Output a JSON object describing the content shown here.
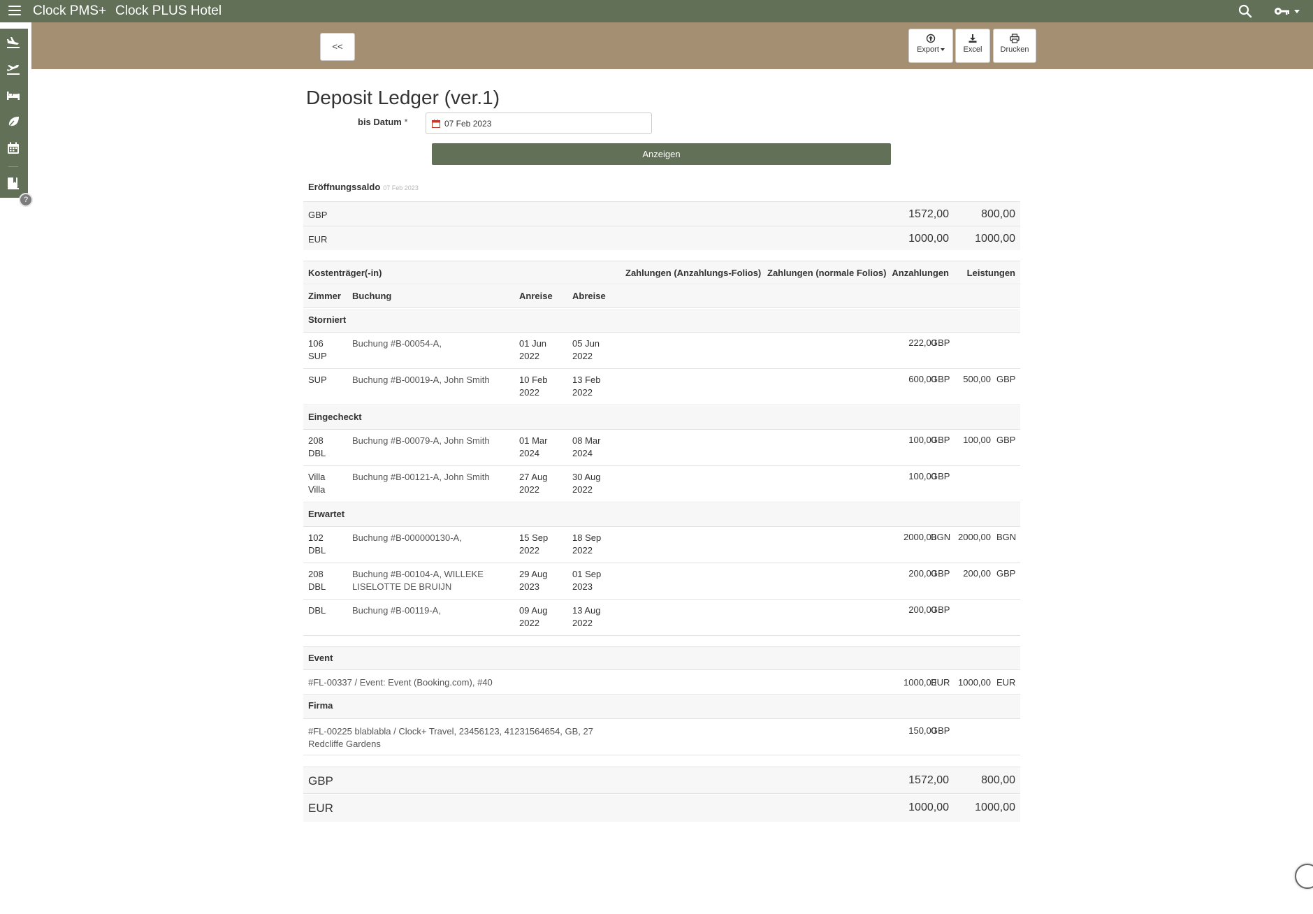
{
  "app": {
    "brand": "Clock PMS+",
    "hotel": "Clock PLUS Hotel"
  },
  "toolbar": {
    "back_label": "<<",
    "export_label": "Export",
    "excel_label": "Excel",
    "print_label": "Drucken"
  },
  "sidebar": {
    "items": [
      {
        "icon": "plane-arrival-icon"
      },
      {
        "icon": "plane-departure-icon"
      },
      {
        "icon": "bed-icon"
      },
      {
        "icon": "leaf-icon"
      },
      {
        "icon": "calendar-icon"
      },
      {
        "icon": "bookmark-book-icon"
      }
    ],
    "help": "?"
  },
  "page": {
    "title": "Deposit Ledger (ver.1)",
    "date_label": "bis Datum",
    "required_mark": "*",
    "date_value": "07 Feb 2023",
    "show_button": "Anzeigen"
  },
  "opening": {
    "label": "Eröffnungssaldo",
    "date": "07 Feb 2023",
    "rows": [
      {
        "currency": "GBP",
        "deposits": "1572,00",
        "services": "800,00"
      },
      {
        "currency": "EUR",
        "deposits": "1000,00",
        "services": "1000,00"
      }
    ]
  },
  "headers": {
    "payer": "Kostenträger(-in)",
    "payments_deposit": "Zahlungen (Anzahlungs-Folios)",
    "payments_normal": "Zahlungen (normale Folios)",
    "deposits": "Anzahlungen",
    "services": "Leistungen",
    "room": "Zimmer",
    "booking": "Buchung",
    "arrival": "Anreise",
    "departure": "Abreise"
  },
  "groups": {
    "cancelled": {
      "label": "Storniert",
      "rows": [
        {
          "room": "106\nSUP",
          "booking": "Buchung #B-00054-A,",
          "arrival": "01 Jun\n2022",
          "departure": "05 Jun\n2022",
          "dep_amount": "222,00",
          "dep_cur": "GBP",
          "svc_amount": "",
          "svc_cur": ""
        },
        {
          "room": "SUP",
          "booking": "Buchung #B-00019-A, John Smith",
          "arrival": "10 Feb\n2022",
          "departure": "13 Feb\n2022",
          "dep_amount": "600,00",
          "dep_cur": "GBP",
          "svc_amount": "500,00",
          "svc_cur": "GBP"
        }
      ]
    },
    "checked_in": {
      "label": "Eingecheckt",
      "rows": [
        {
          "room": "208\nDBL",
          "booking": "Buchung #B-00079-A, John Smith",
          "arrival": "01 Mar\n2024",
          "departure": "08 Mar\n2024",
          "dep_amount": "100,00",
          "dep_cur": "GBP",
          "svc_amount": "100,00",
          "svc_cur": "GBP"
        },
        {
          "room": "Villa\nVilla",
          "booking": "Buchung #B-00121-A, John Smith",
          "arrival": "27 Aug\n2022",
          "departure": "30 Aug\n2022",
          "dep_amount": "100,00",
          "dep_cur": "GBP",
          "svc_amount": "",
          "svc_cur": ""
        }
      ]
    },
    "expected": {
      "label": "Erwartet",
      "rows": [
        {
          "room": "102\nDBL",
          "booking": "Buchung #B-000000130-A,",
          "arrival": "15 Sep\n2022",
          "departure": "18 Sep\n2022",
          "dep_amount": "2000,00",
          "dep_cur": "BGN",
          "svc_amount": "2000,00",
          "svc_cur": "BGN"
        },
        {
          "room": "208\nDBL",
          "booking": "Buchung #B-00104-A, WILLEKE\nLISELOTTE DE BRUIJN",
          "arrival": "29 Aug\n2023",
          "departure": "01 Sep\n2023",
          "dep_amount": "200,00",
          "dep_cur": "GBP",
          "svc_amount": "200,00",
          "svc_cur": "GBP"
        },
        {
          "room": "DBL",
          "booking": "Buchung #B-00119-A,",
          "arrival": "09 Aug\n2022",
          "departure": "13 Aug\n2022",
          "dep_amount": "200,00",
          "dep_cur": "GBP",
          "svc_amount": "",
          "svc_cur": ""
        }
      ]
    }
  },
  "event": {
    "label": "Event",
    "row": {
      "text": "#FL-00337 / Event: Event (Booking.com), #40",
      "dep_amount": "1000,00",
      "dep_cur": "EUR",
      "svc_amount": "1000,00",
      "svc_cur": "EUR"
    }
  },
  "company": {
    "label": "Firma",
    "row": {
      "text": "#FL-00225 blablabla / Clock+ Travel, 23456123, 41231564654, GB, 27\nRedcliffe Gardens",
      "dep_amount": "150,00",
      "dep_cur": "GBP"
    }
  },
  "totals": [
    {
      "currency": "GBP",
      "deposits": "1572,00",
      "services": "800,00"
    },
    {
      "currency": "EUR",
      "deposits": "1000,00",
      "services": "1000,00"
    }
  ]
}
